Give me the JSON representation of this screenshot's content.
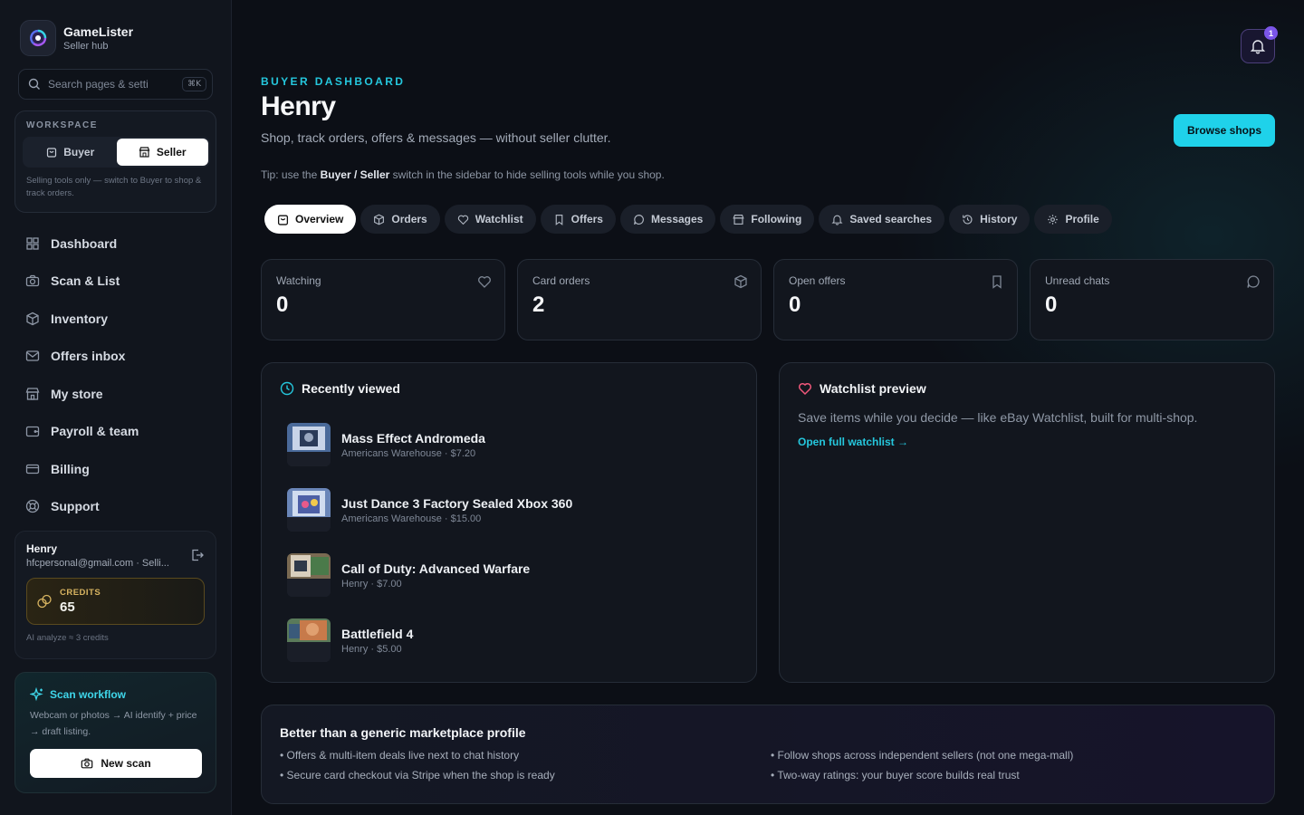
{
  "brand": {
    "name": "GameLister",
    "subtitle": "Seller hub"
  },
  "search": {
    "placeholder": "Search pages & setti",
    "shortcut": "⌘K"
  },
  "workspace": {
    "title": "WORKSPACE",
    "buyer_label": "Buyer",
    "seller_label": "Seller",
    "active": "Seller",
    "note": "Selling tools only — switch to Buyer to shop & track orders."
  },
  "nav": {
    "items": [
      {
        "label": "Dashboard",
        "icon": "grid-icon"
      },
      {
        "label": "Scan & List",
        "icon": "camera-icon"
      },
      {
        "label": "Inventory",
        "icon": "box-icon"
      },
      {
        "label": "Offers inbox",
        "icon": "mail-icon"
      },
      {
        "label": "My store",
        "icon": "store-icon"
      },
      {
        "label": "Payroll & team",
        "icon": "wallet-icon"
      },
      {
        "label": "Billing",
        "icon": "card-icon"
      },
      {
        "label": "Support",
        "icon": "lifebuoy-icon"
      }
    ]
  },
  "user": {
    "name": "Henry",
    "email": "hfcpersonal@gmail.com · Selli...",
    "credits_label": "CREDITS",
    "credits_value": "65",
    "credits_note": "AI analyze ≈ 3 credits"
  },
  "scan": {
    "title": "Scan workflow",
    "description": "Webcam or photos → AI identify + price → draft listing.",
    "button_label": "New scan"
  },
  "notifications": {
    "count": "1"
  },
  "header": {
    "eyebrow": "BUYER DASHBOARD",
    "title": "Henry",
    "subtitle": "Shop, track orders, offers & messages — without seller clutter.",
    "tip_prefix": "Tip: use the ",
    "tip_bold": "Buyer / Seller",
    "tip_suffix": " switch in the sidebar to hide selling tools while you shop.",
    "browse_label": "Browse shops"
  },
  "tabs": [
    {
      "label": "Overview",
      "icon": "bag-icon",
      "active": true
    },
    {
      "label": "Orders",
      "icon": "box-icon"
    },
    {
      "label": "Watchlist",
      "icon": "heart-icon"
    },
    {
      "label": "Offers",
      "icon": "bookmark-icon"
    },
    {
      "label": "Messages",
      "icon": "chat-icon"
    },
    {
      "label": "Following",
      "icon": "store-icon"
    },
    {
      "label": "Saved searches",
      "icon": "bell-icon"
    },
    {
      "label": "History",
      "icon": "history-icon"
    },
    {
      "label": "Profile",
      "icon": "gear-icon"
    }
  ],
  "stats": [
    {
      "label": "Watching",
      "value": "0",
      "icon": "heart-icon"
    },
    {
      "label": "Card orders",
      "value": "2",
      "icon": "box-icon"
    },
    {
      "label": "Open offers",
      "value": "0",
      "icon": "bookmark-icon"
    },
    {
      "label": "Unread chats",
      "value": "0",
      "icon": "chat-icon"
    }
  ],
  "recent": {
    "title": "Recently viewed",
    "items": [
      {
        "title": "Mass Effect Andromeda",
        "meta": "Americans Warehouse · $7.20"
      },
      {
        "title": "Just Dance 3 Factory Sealed Xbox 360",
        "meta": "Americans Warehouse · $15.00"
      },
      {
        "title": "Call of Duty: Advanced Warfare",
        "meta": "Henry · $7.00"
      },
      {
        "title": "Battlefield 4",
        "meta": "Henry · $5.00"
      }
    ]
  },
  "watchlist": {
    "title": "Watchlist preview",
    "description": "Save items while you decide — like eBay Watchlist, built for multi-shop.",
    "link": "Open full watchlist →"
  },
  "better": {
    "title": "Better than a generic marketplace profile",
    "points": [
      "• Offers & multi-item deals live next to chat history",
      "• Follow shops across independent sellers (not one mega-mall)",
      "• Secure card checkout via Stripe when the shop is ready",
      "• Two-way ratings: your buyer score builds real trust"
    ]
  },
  "colors": {
    "accent": "#1fd2ea",
    "credits": "#d9b561",
    "badge": "#7b55e8"
  }
}
